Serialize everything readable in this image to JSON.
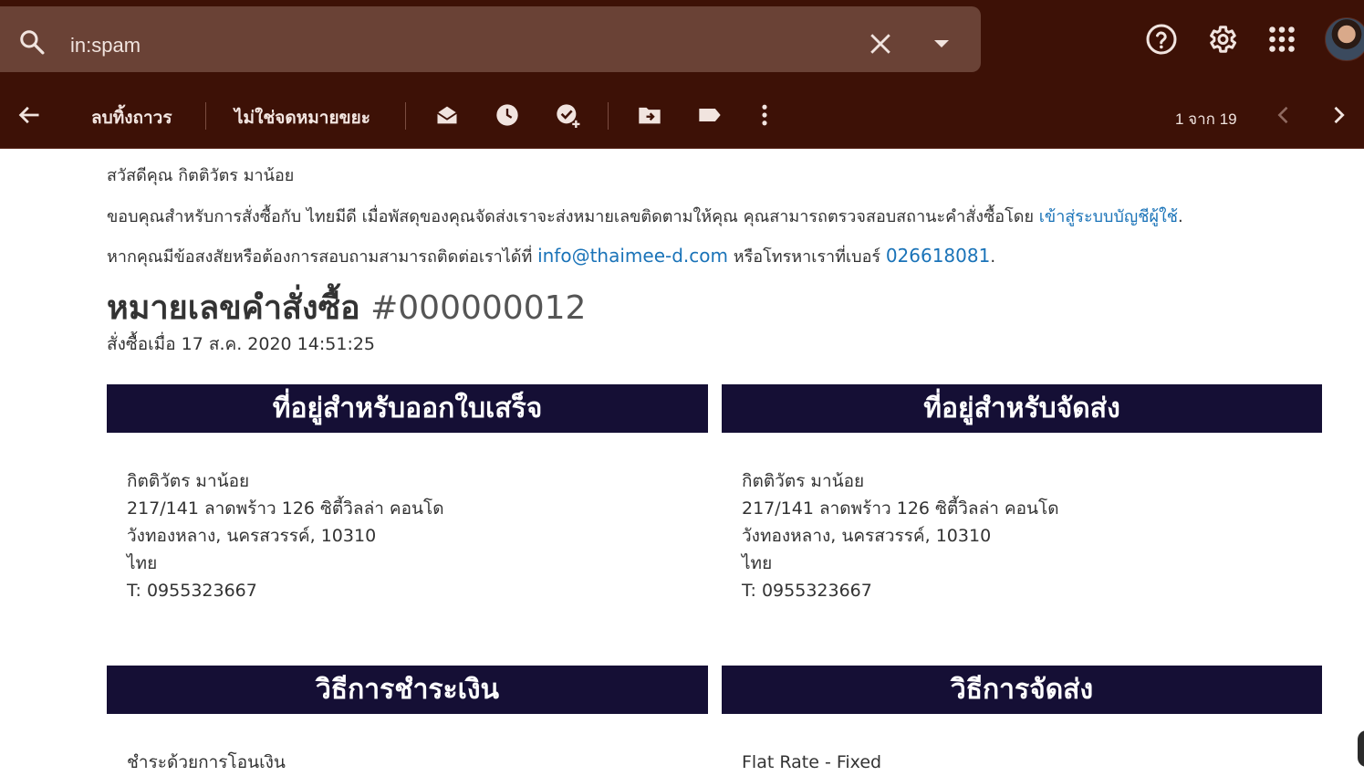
{
  "search": {
    "query": "in:spam"
  },
  "toolbar": {
    "delete_forever_label": "ลบทิ้งถาวร",
    "not_spam_label": "ไม่ใช่จดหมายขยะ",
    "pagination": "1 จาก 19"
  },
  "email": {
    "greeting": "สวัสดีคุณ กิตติวัตร มาน้อย",
    "thanks_text": "ขอบคุณสำหรับการสั่งซื้อกับ ไทยมีดี เมื่อพัสดุของคุณจัดส่งเราจะส่งหมายเลขติดตามให้คุณ คุณสามารถตรวจสอบสถานะคำสั่งซื้อโดย ",
    "login_link": "เข้าสู่ระบบบัญชีผู้ใช้",
    "thanks_end": ".",
    "contact_text": "หากคุณมีข้อสงสัยหรือต้องการสอบถามสามารถติดต่อเราได้ที่ ",
    "contact_email": "info@thaimee-d.com",
    "contact_mid": " หรือโทรหาเราที่เบอร์ ",
    "contact_phone": "026618081",
    "contact_end": ".",
    "order_label": "หมายเลขคำสั่งซื้อ",
    "order_number": "#000000012",
    "order_date": "สั่งซื้อเมื่อ 17 ส.ค. 2020 14:51:25",
    "billing": {
      "heading": "ที่อยู่สำหรับออกใบเสร็จ",
      "name": "กิตติวัตร มาน้อย",
      "street": "217/141 ลาดพร้าว 126 ซิตี้วิลล่า คอนโด",
      "city": "วังทองหลาง, นครสวรรค์, 10310",
      "country": "ไทย",
      "phone": "T: 0955323667"
    },
    "shipping": {
      "heading": "ที่อยู่สำหรับจัดส่ง",
      "name": "กิตติวัตร มาน้อย",
      "street": "217/141 ลาดพร้าว 126 ซิตี้วิลล่า คอนโด",
      "city": "วังทองหลาง, นครสวรรค์, 10310",
      "country": "ไทย",
      "phone": "T: 0955323667"
    },
    "payment": {
      "heading": "วิธีการชำระเงิน",
      "method": "ชำระด้วยการโอนเงิน"
    },
    "delivery": {
      "heading": "วิธีการจัดส่ง",
      "method": "Flat Rate - Fixed"
    }
  },
  "colors": {
    "header_bg": "#3d1106",
    "search_bg": "#6a4236",
    "block_header_bg": "#150f35",
    "link": "#1a73b8"
  }
}
